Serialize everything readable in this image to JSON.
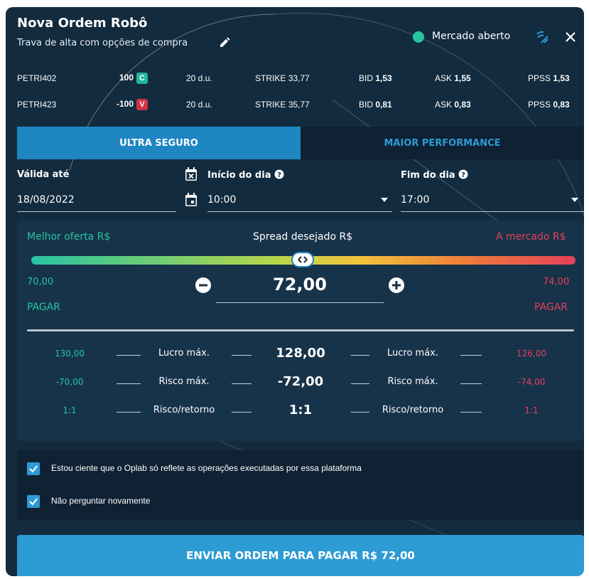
{
  "header": {
    "title": "Nova Ordem Robô",
    "subtitle": "Trava de alta com opções de compra",
    "market_status": "Mercado aberto",
    "status_color": "#27c4a1",
    "icons": [
      "edit-icon",
      "signal-icon",
      "close-icon"
    ]
  },
  "legs": [
    {
      "symbol": "PETRI402",
      "qty": "100",
      "side": "C",
      "unit": "20 d.u.",
      "strike_label": "STRIKE",
      "strike": "33,77",
      "bid_label": "BID",
      "bid": "1,53",
      "ask_label": "ASK",
      "ask": "1,55",
      "ppss_label": "PPSS",
      "ppss": "1,53"
    },
    {
      "symbol": "PETRI423",
      "qty": "-100",
      "side": "V",
      "unit": "20 d.u.",
      "strike_label": "STRIKE",
      "strike": "35,77",
      "bid_label": "BID",
      "bid": "0,81",
      "ask_label": "ASK",
      "ask": "0,83",
      "ppss_label": "PPSS",
      "ppss": "0,83"
    }
  ],
  "tabs": [
    {
      "label": "ULTRA SEGURO",
      "active": true
    },
    {
      "label": "MAIOR PERFORMANCE",
      "active": false
    }
  ],
  "fields": {
    "valid_until": {
      "label": "Válida até",
      "value": "18/08/2022"
    },
    "start": {
      "label": "Início do dia",
      "value": "10:00"
    },
    "end": {
      "label": "Fim do dia",
      "value": "17:00"
    }
  },
  "spread": {
    "best_label": "Melhor oferta R$",
    "spread_label": "Spread desejado R$",
    "market_label": "A mercado R$",
    "min_value": "70,00",
    "max_value": "74,00",
    "current_value": "72,00",
    "min_action": "PAGAR",
    "max_action": "PAGAR",
    "slider_fraction": 0.5
  },
  "metrics": [
    {
      "left": "130,00",
      "label_left": "Lucro máx.",
      "center": "128,00",
      "label_right": "Lucro máx.",
      "right": "126,00"
    },
    {
      "left": "-70,00",
      "label_left": "Risco máx.",
      "center": "-72,00",
      "label_right": "Risco máx.",
      "right": "-74,00"
    },
    {
      "left": "1:1",
      "label_left": "Risco/retorno",
      "center": "1:1",
      "label_right": "Risco/retorno",
      "right": "1:1"
    }
  ],
  "consent": {
    "ack": "Estou ciente que o Oplab só reflete as operações executadas por essa plataforma",
    "dont_ask": "Não perguntar novamente"
  },
  "submit_label": "ENVIAR ORDEM PARA PAGAR R$ 72,00",
  "colors": {
    "accent": "#2d9bd4",
    "buy": "#27c4a1",
    "sell": "#e4405a",
    "background": "#122b3e"
  }
}
